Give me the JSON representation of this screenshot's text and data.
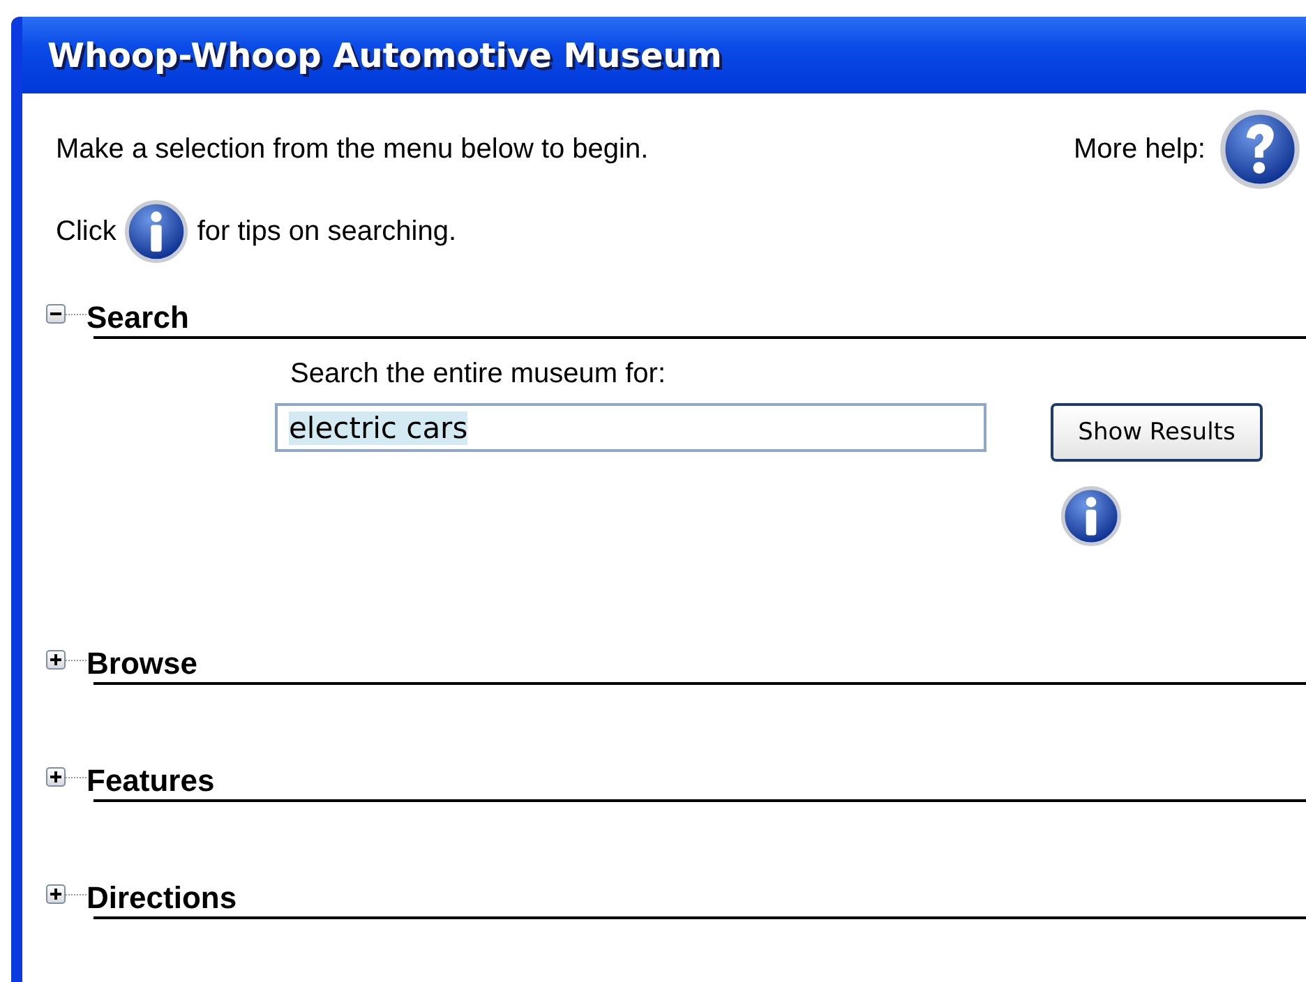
{
  "window": {
    "title": "Whoop-Whoop Automotive Museum"
  },
  "intro": {
    "text": "Make a selection from the menu below to begin.",
    "help_label": "More help:",
    "tip_before": "Click",
    "tip_after": "for tips on searching."
  },
  "sections": [
    {
      "label": "Search",
      "expanded": true,
      "search": {
        "label": "Search the entire museum for:",
        "value": "electric cars",
        "button": "Show Results"
      }
    },
    {
      "label": "Browse",
      "expanded": false
    },
    {
      "label": "Features",
      "expanded": false
    },
    {
      "label": "Directions",
      "expanded": false
    }
  ]
}
